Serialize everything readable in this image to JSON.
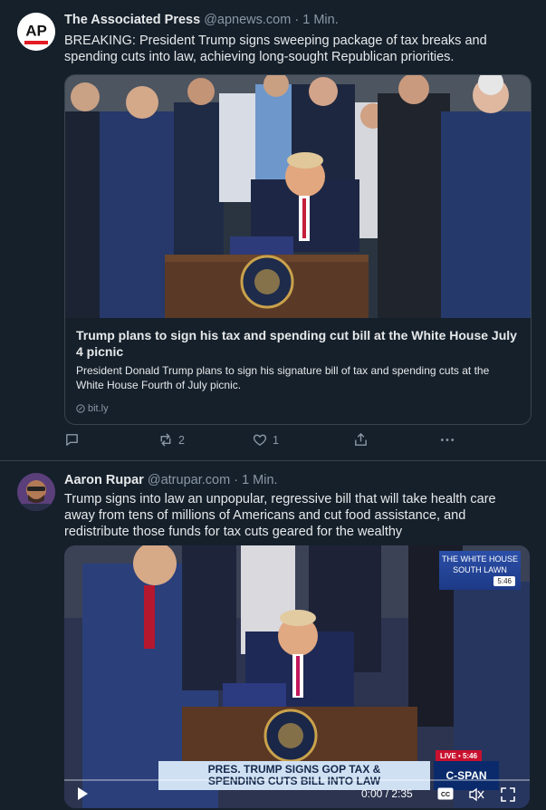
{
  "posts": [
    {
      "author_name": "The Associated Press",
      "handle": "@apnews.com",
      "separator": "·",
      "time": "1 Min.",
      "avatar_text": "AP",
      "text": "BREAKING: President Trump signs sweeping package of tax breaks and spending cuts into law, achieving long-sought Republican priorities.",
      "card": {
        "title": "Trump plans to sign his tax and spending cut bill at the White House July 4 picnic",
        "description": "President Donald Trump plans to sign his signature bill of tax and spending cuts at the White House Fourth of July picnic.",
        "domain": "bit.ly"
      },
      "actions": {
        "reply_count": "",
        "repost_count": "2",
        "like_count": "1"
      }
    },
    {
      "author_name": "Aaron Rupar",
      "handle": "@atrupar.com",
      "separator": "·",
      "time": "1 Min.",
      "text": "Trump signs into law an unpopular, regressive bill that will take health care away from tens of millions of Americans and cut food assistance, and redistribute those funds for tax cuts geared for the wealthy",
      "video": {
        "overlay_top_line1": "THE WHITE HOUSE",
        "overlay_top_line2": "SOUTH LAWN",
        "overlay_clock": "5:46",
        "live_label": "LIVE",
        "live_time": "5:46",
        "lower_third_line1": "PRES. TRUMP SIGNS GOP TAX &",
        "lower_third_line2": "SPENDING CUTS BILL INTO LAW",
        "network": "C-SPAN",
        "time_display": "0:00 / 2:35",
        "cc_label": "CC",
        "progress": 0
      }
    }
  ],
  "icons": {
    "reply": "reply-icon",
    "repost": "repost-icon",
    "like": "heart-icon",
    "share": "share-icon",
    "more": "more-icon",
    "link": "link-icon",
    "play": "play-icon",
    "captions": "captions-icon",
    "mute": "mute-icon",
    "fullscreen": "fullscreen-icon"
  },
  "colors": {
    "background": "#15202b",
    "border": "#38444d",
    "text": "#e7e9ea",
    "muted": "#8b98a5",
    "ap_red": "#e31b23"
  }
}
